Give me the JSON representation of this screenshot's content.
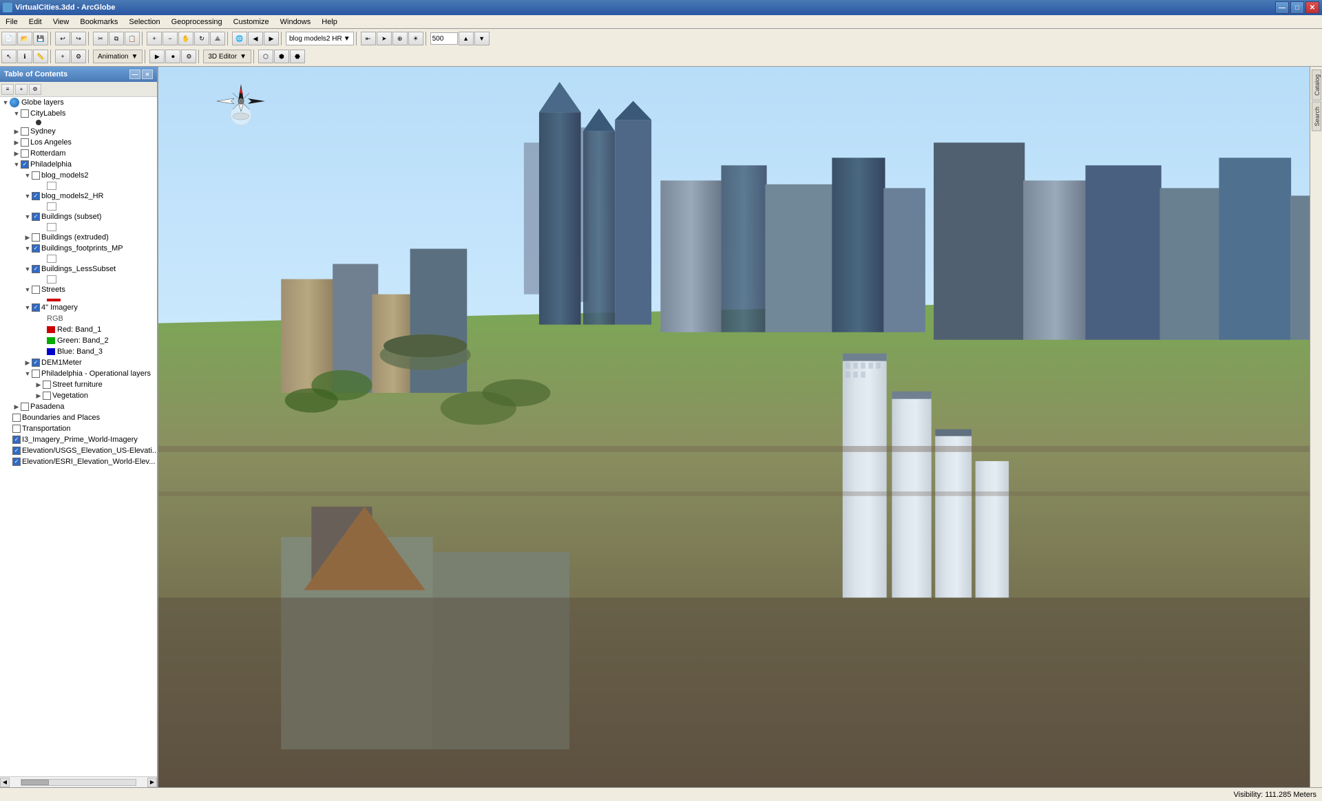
{
  "app": {
    "title": "VirtualCities.3dd - ArcGlobe",
    "icon": "globe"
  },
  "menus": {
    "items": [
      "File",
      "Edit",
      "View",
      "Bookmarks",
      "Selection",
      "Geoprocessing",
      "Customize",
      "Windows",
      "Help"
    ]
  },
  "toolbar": {
    "dropdown": "blog models2 HR",
    "spinbox_value": "500",
    "animation_label": "Animation",
    "editor_3d_label": "3D Editor"
  },
  "toc": {
    "title": "Table of Contents",
    "close_btn": "×",
    "minimize_btn": "—",
    "layers": [
      {
        "id": "globe-layers",
        "label": "Globe layers",
        "type": "globe-root",
        "expanded": true,
        "indent": 0,
        "checked": null
      },
      {
        "id": "city-labels",
        "label": "CityLabels",
        "type": "layer",
        "expanded": true,
        "indent": 1,
        "checked": false
      },
      {
        "id": "city-labels-dot",
        "label": "",
        "type": "legend-dot",
        "indent": 2,
        "checked": null
      },
      {
        "id": "sydney",
        "label": "Sydney",
        "type": "layer",
        "expanded": false,
        "indent": 1,
        "checked": false
      },
      {
        "id": "los-angeles",
        "label": "Los Angeles",
        "type": "layer",
        "expanded": false,
        "indent": 1,
        "checked": false
      },
      {
        "id": "rotterdam",
        "label": "Rotterdam",
        "type": "layer",
        "expanded": false,
        "indent": 1,
        "checked": false
      },
      {
        "id": "philadelphia",
        "label": "Philadelphia",
        "type": "layer",
        "expanded": true,
        "indent": 1,
        "checked": true
      },
      {
        "id": "blog-models2",
        "label": "blog_models2",
        "type": "layer",
        "expanded": true,
        "indent": 2,
        "checked": false
      },
      {
        "id": "blog-models2-swatch",
        "label": "",
        "type": "swatch",
        "indent": 3,
        "color": "white",
        "checked": null
      },
      {
        "id": "blog-models2-hr",
        "label": "blog_models2_HR",
        "type": "layer",
        "expanded": true,
        "indent": 2,
        "checked": true
      },
      {
        "id": "blog-models2-hr-swatch",
        "label": "",
        "type": "swatch",
        "indent": 3,
        "color": "white",
        "checked": null
      },
      {
        "id": "buildings-subset",
        "label": "Buildings (subset)",
        "type": "layer",
        "expanded": true,
        "indent": 2,
        "checked": true
      },
      {
        "id": "buildings-subset-swatch",
        "label": "",
        "type": "swatch",
        "indent": 3,
        "color": "white",
        "checked": null
      },
      {
        "id": "buildings-extruded",
        "label": "Buildings (extruded)",
        "type": "layer",
        "expanded": false,
        "indent": 2,
        "checked": false
      },
      {
        "id": "buildings-footprints-mp",
        "label": "Buildings_footprints_MP",
        "type": "layer",
        "expanded": true,
        "indent": 2,
        "checked": true
      },
      {
        "id": "buildings-footprints-swatch",
        "label": "",
        "type": "swatch",
        "indent": 3,
        "color": "white",
        "checked": null
      },
      {
        "id": "buildings-lesssubset",
        "label": "Buildings_LessSubset",
        "type": "layer",
        "expanded": true,
        "indent": 2,
        "checked": true
      },
      {
        "id": "buildings-lesssubset-swatch",
        "label": "",
        "type": "swatch",
        "indent": 3,
        "color": "white",
        "checked": null
      },
      {
        "id": "streets",
        "label": "Streets",
        "type": "layer",
        "expanded": true,
        "indent": 2,
        "checked": false
      },
      {
        "id": "streets-swatch-red",
        "label": "",
        "type": "line-swatch",
        "indent": 3,
        "color": "#cc0000",
        "checked": null
      },
      {
        "id": "imagery-4in",
        "label": "4\" Imagery",
        "type": "layer",
        "expanded": true,
        "indent": 2,
        "checked": true
      },
      {
        "id": "imagery-rgb",
        "label": "RGB",
        "type": "sublabel",
        "indent": 3,
        "checked": null
      },
      {
        "id": "imagery-red",
        "label": "Red:   Band_1",
        "type": "band",
        "indent": 3,
        "color": "#cc0000",
        "checked": null
      },
      {
        "id": "imagery-green",
        "label": "Green: Band_2",
        "type": "band",
        "indent": 3,
        "color": "#00aa00",
        "checked": null
      },
      {
        "id": "imagery-blue",
        "label": "Blue:  Band_3",
        "type": "band",
        "indent": 3,
        "color": "#0000cc",
        "checked": null
      },
      {
        "id": "dem1meter",
        "label": "DEM1Meter",
        "type": "layer",
        "expanded": false,
        "indent": 2,
        "checked": true
      },
      {
        "id": "philly-operational",
        "label": "Philadelphia - Operational layers",
        "type": "layer",
        "expanded": true,
        "indent": 2,
        "checked": false
      },
      {
        "id": "street-furniture",
        "label": "Street furniture",
        "type": "layer",
        "expanded": false,
        "indent": 3,
        "checked": false
      },
      {
        "id": "vegetation",
        "label": "Vegetation",
        "type": "layer",
        "expanded": false,
        "indent": 3,
        "checked": false
      },
      {
        "id": "pasadena",
        "label": "Pasadena",
        "type": "layer",
        "expanded": false,
        "indent": 1,
        "checked": false
      },
      {
        "id": "boundaries-places",
        "label": "Boundaries and Places",
        "type": "layer",
        "expanded": false,
        "indent": 0,
        "checked": false
      },
      {
        "id": "transportation",
        "label": "Transportation",
        "type": "layer",
        "expanded": false,
        "indent": 0,
        "checked": false
      },
      {
        "id": "i3-imagery",
        "label": "I3_Imagery_Prime_World-Imagery",
        "type": "layer",
        "expanded": false,
        "indent": 0,
        "checked": true
      },
      {
        "id": "elevation-usgs",
        "label": "Elevation/USGS_Elevation_US-Elevati...",
        "type": "layer",
        "expanded": false,
        "indent": 0,
        "checked": true
      },
      {
        "id": "elevation-esri",
        "label": "Elevation/ESRI_Elevation_World-Elev...",
        "type": "layer",
        "expanded": false,
        "indent": 0,
        "checked": true
      }
    ]
  },
  "status_bar": {
    "visibility_label": "Visibility:",
    "visibility_value": "111.285 Meters"
  },
  "right_tabs": [
    "Catalog",
    "Search"
  ],
  "compass": {
    "label": "Navigation compass"
  }
}
